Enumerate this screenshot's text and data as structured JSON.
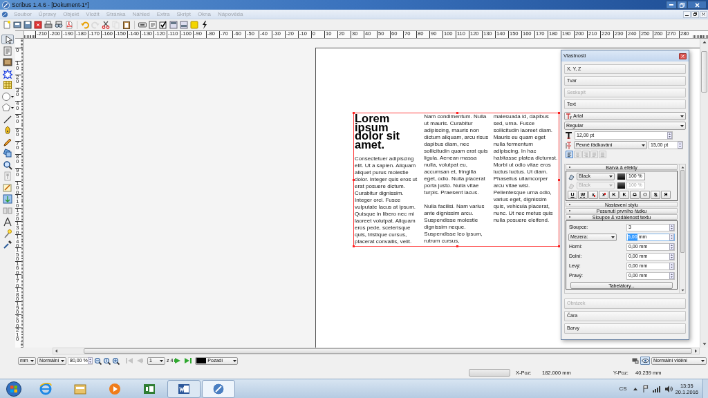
{
  "window": {
    "title": "Scribus 1.4.6 - [Dokument-1*]"
  },
  "menu": [
    {
      "label": "Soubor",
      "disabled": true
    },
    {
      "label": "Úpravy",
      "disabled": true
    },
    {
      "label": "Objekt",
      "disabled": true
    },
    {
      "label": "Vložit",
      "disabled": true
    },
    {
      "label": "Stránka",
      "disabled": true
    },
    {
      "label": "Náhled",
      "disabled": true
    },
    {
      "label": "Extra",
      "disabled": true
    },
    {
      "label": "Skript",
      "disabled": true
    },
    {
      "label": "Okna",
      "disabled": true
    },
    {
      "label": "Nápověda",
      "disabled": true
    }
  ],
  "toolbar": [
    {
      "disabled": false
    },
    {
      "disabled": false
    },
    {
      "disabled": false
    },
    {
      "disabled": false
    },
    {
      "disabled": false
    },
    {
      "disabled": false
    },
    {
      "disabled": false
    },
    {
      "disabled": false
    },
    {
      "disabled": true
    },
    {
      "disabled": false
    },
    {
      "disabled": true
    },
    {
      "disabled": false
    },
    {
      "disabled": false
    },
    {
      "disabled": false
    },
    {
      "disabled": false
    },
    {
      "disabled": false
    },
    {
      "disabled": false
    },
    {
      "disabled": false
    },
    {
      "disabled": false
    }
  ],
  "toolbox": [
    {
      "selected": true
    },
    {
      "selected": false
    },
    {
      "selected": false
    },
    {
      "selected": false
    },
    {
      "selected": false
    },
    {
      "selected": false
    },
    {
      "selected": false
    },
    {
      "selected": false
    },
    {
      "selected": false
    },
    {
      "selected": false
    },
    {
      "selected": false
    },
    {
      "selected": false
    },
    {
      "selected": false
    },
    {
      "selected": false
    },
    {
      "selected": false
    },
    {
      "selected": false
    },
    {
      "selected": false
    },
    {
      "selected": false
    },
    {
      "selected": false
    }
  ],
  "horizontal_ruler": {
    "labels": [
      "-210",
      "-200",
      "-190",
      "-180",
      "-170",
      "-160",
      "-150",
      "-140",
      "-130",
      "-120",
      "-110",
      "-100",
      "-90",
      "-80",
      "-70",
      "-60",
      "-50",
      "-40",
      "-30",
      "-20",
      "-10",
      "0",
      "10",
      "20",
      "30",
      "40",
      "50",
      "60",
      "70",
      "80",
      "90",
      "100",
      "110",
      "120",
      "130",
      "140",
      "150",
      "160",
      "170",
      "180",
      "190",
      "200",
      "210",
      "220",
      "230",
      "240",
      "250",
      "260",
      "270",
      "280"
    ]
  },
  "vertical_ruler": {
    "labels": [
      "0",
      "10",
      "20",
      "30",
      "40",
      "50",
      "60",
      "70",
      "80",
      "90",
      "100",
      "110",
      "120",
      "130",
      "140",
      "150",
      "160",
      "170",
      "180",
      "190",
      "200",
      "210"
    ]
  },
  "text_frame": {
    "columns": [
      {
        "heading": "Lorem ipsum dolor sit amet.",
        "paragraphs": [
          "Consectetuer adipiscing elit. Ut a sapien. Aliquam aliquet purus molestie dolor. Integer quis eros ut erat posuere dictum. Curabitur dignissim. Integer orci. Fusce vulputate lacus at ipsum. Quisque in libero nec mi laoreet volutpat. Aliquam eros pede, scelerisque quis, tristique cursus, placerat convallis, velit."
        ]
      },
      {
        "paragraphs": [
          "Nam condimentum. Nulla ut mauris. Curabitur adipiscing, mauris non dictum aliquam, arcu risus dapibus diam, nec sollicitudin quam erat quis ligula. Aenean massa nulla, volutpat eu, accumsan et, fringilla eget, odio. Nulla placerat porta justo. Nulla vitae turpis. Praesent lacus.",
          "Nulla facilisi. Nam varius ante dignissim arcu. Suspendisse molestie dignissim neque. Suspendisse leo ipsum, rutrum cursus,"
        ]
      },
      {
        "paragraphs": [
          "malesuada id, dapibus sed, urna. Fusce sollicitudin laoreet diam. Mauris eu quam eget nulla fermentum adipiscing. In hac habitasse platea dictumst. Morbi ut odio vitae eros luctus luctus. Ut diam. Phasellus ullamcorper arcu vitae wisi. Pellentesque urna odio, varius eget, dignissim quis, vehicula placerat, nunc. Ut nec metus quis nulla posuere eleifend."
        ]
      }
    ]
  },
  "properties": {
    "title": "Vlastnosti",
    "sections_top": [
      {
        "label": "X, Y, Z",
        "disabled": false
      },
      {
        "label": "Tvar",
        "disabled": false
      },
      {
        "label": "Seskupit",
        "disabled": true
      },
      {
        "label": "Text",
        "disabled": false
      }
    ],
    "text": {
      "font": "Arial",
      "style": "Regular",
      "size": "12,00 pt",
      "spacing_mode": "Pevné řádkování",
      "line_spacing": "15,00 pt",
      "alignment": [
        {
          "selected": true
        },
        {
          "selected": false
        },
        {
          "selected": false
        },
        {
          "selected": false
        },
        {
          "selected": false
        }
      ],
      "color_effects": {
        "title": "Barva & efekty",
        "fill": {
          "name": "Black",
          "shade": "100 %",
          "disabled": false
        },
        "stroke": {
          "name": "Black",
          "shade": "100 %",
          "disabled": true
        },
        "effects": [
          {
            "kind": "underline",
            "label": "U"
          },
          {
            "kind": "word_underline",
            "label": "W"
          },
          {
            "kind": "subscript",
            "label": "x"
          },
          {
            "kind": "superscript",
            "label": "x"
          },
          {
            "kind": "all_caps",
            "label": "K"
          },
          {
            "kind": "small_caps",
            "label": "K"
          },
          {
            "kind": "strikethrough",
            "label": "O"
          },
          {
            "kind": "outline",
            "label": "O"
          },
          {
            "kind": "shadow",
            "label": "S"
          },
          {
            "kind": "reverse",
            "label": "Я"
          }
        ]
      },
      "collapsed": [
        "Nastavení stylu",
        "Posunutí prvního řádku"
      ],
      "columns": {
        "title": "Sloupce & vzdálenost textu",
        "fields": [
          {
            "kind": "plain",
            "label": "Sloupce:",
            "value": "3"
          },
          {
            "kind": "dropdown",
            "label": "Mezera:",
            "selected_value": "5,00",
            "unit": "mm"
          },
          {
            "kind": "plain",
            "label": "Horní:",
            "value": "0,00 mm"
          },
          {
            "kind": "plain",
            "label": "Dolní:",
            "value": "0,00 mm"
          },
          {
            "kind": "plain",
            "label": "Levý:",
            "value": "0,00 mm"
          },
          {
            "kind": "plain",
            "label": "Pravý:",
            "value": "0,00 mm"
          }
        ],
        "button": "Tabelátory..."
      }
    },
    "sections_bottom": [
      {
        "label": "Obrázek",
        "disabled": true
      },
      {
        "label": "Čára",
        "disabled": false
      },
      {
        "label": "Barvy",
        "disabled": false
      }
    ]
  },
  "bottom_bar": {
    "unit": "mm",
    "mode": "Normální",
    "zoom": "80,00 %",
    "nav": [
      {
        "disabled": true
      },
      {
        "disabled": true
      }
    ],
    "page": "1",
    "page_count": "z 4",
    "nav_next": [
      {
        "disabled": false
      },
      {
        "disabled": false
      }
    ],
    "layer": "Pozadí",
    "view": "Normální vidění"
  },
  "status": {
    "x_label": "X-Poz:",
    "x_value": "182.000 mm",
    "y_label": "Y-Poz:",
    "y_value": "40.239 mm"
  },
  "taskbar": {
    "apps": [
      {
        "running": false,
        "selected": false
      },
      {
        "running": false,
        "selected": false
      },
      {
        "running": false,
        "selected": false
      },
      {
        "running": false,
        "selected": false
      },
      {
        "running": true,
        "selected": false
      },
      {
        "running": true,
        "selected": true
      }
    ],
    "language": "CS",
    "time": "13:35",
    "date": "20.1.2016"
  }
}
